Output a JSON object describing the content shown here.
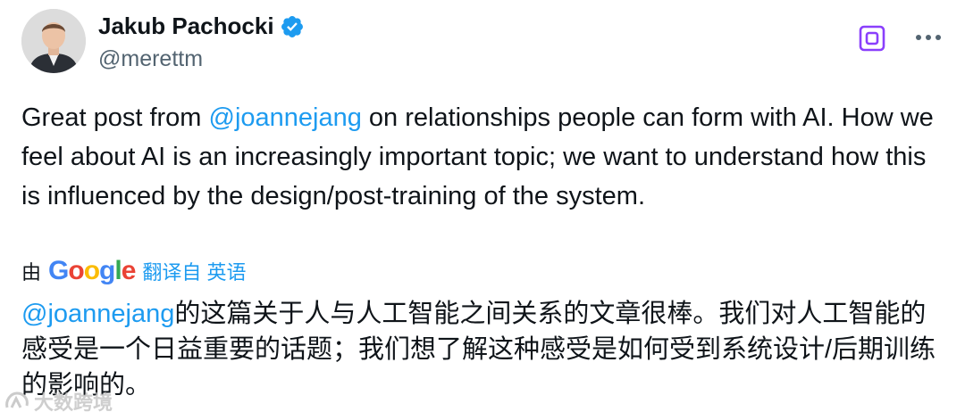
{
  "author": {
    "display_name": "Jakub Pachocki",
    "handle": "@merettm",
    "verified": true
  },
  "colors": {
    "link": "#1d9bf0",
    "verified": "#1d9bf0",
    "grok_accent": "#8a3ffc",
    "text": "#0f1419",
    "secondary": "#536471"
  },
  "icons": {
    "verified": "verified-badge-icon",
    "grok": "grok-icon",
    "more": "more-options-icon",
    "watermark": "watermark-logo-icon"
  },
  "tweet": {
    "text_before": "Great post from ",
    "mention": "@joannejang",
    "text_after": " on relationships people can form with AI. How we feel about AI is an increasingly important topic; we want to understand how this is influenced by the design/post-training of the system."
  },
  "translation": {
    "by_label": "由",
    "provider": "Google",
    "link_label": "翻译自 英语",
    "mention": "@joannejang",
    "text": "的这篇关于人与人工智能之间关系的文章很棒。我们对人工智能的感受是一个日益重要的话题；我们想了解这种感受是如何受到系统设计/后期训练的影响的。"
  },
  "watermark": {
    "text": "大数跨境"
  }
}
